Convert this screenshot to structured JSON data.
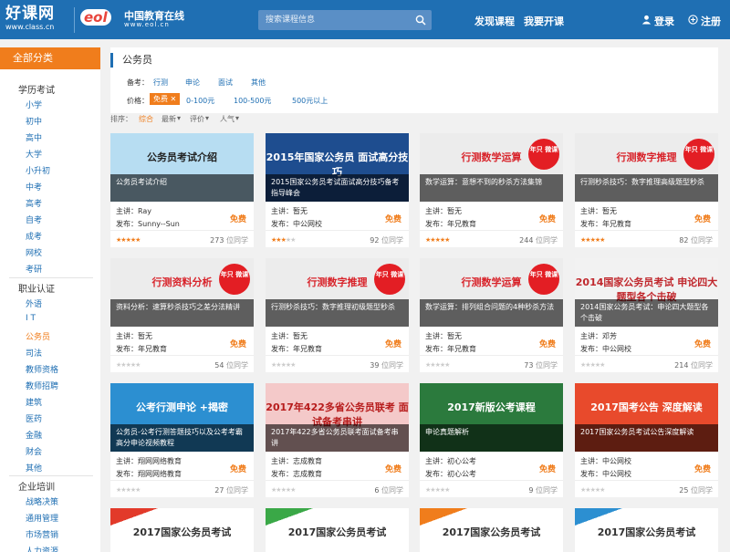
{
  "header": {
    "logo": "好课网",
    "logo_url": "www.class.cn",
    "partner_mark": "eol",
    "partner_name": "中国教育在线",
    "partner_url": "www.eol.cn",
    "search_placeholder": "搜索课程信息",
    "nav": [
      "发现课程",
      "我要开课"
    ],
    "login": "登录",
    "register": "注册"
  },
  "sidebar": {
    "title": "全部分类",
    "groups": [
      {
        "name": "学历考试",
        "items": [
          "小学",
          "初中",
          "高中",
          "大学",
          "小升初",
          "中考",
          "高考",
          "自考",
          "成考",
          "网校",
          "考研"
        ]
      },
      {
        "name": "职业认证",
        "items": [
          "外语",
          "I T",
          "公务员",
          "司法",
          "教师资格",
          "教师招聘",
          "建筑",
          "医药",
          "金融",
          "财会",
          "其他"
        ]
      },
      {
        "name": "企业培训",
        "items": [
          "战略决策",
          "通用管理",
          "市场营销",
          "人力资源"
        ]
      }
    ],
    "active_item": "公务员"
  },
  "filter": {
    "title": "公务员",
    "type_label": "备考：",
    "types": [
      "行测",
      "申论",
      "面试",
      "其他"
    ],
    "price_label": "价格：",
    "price_selected": "免费 ✕",
    "prices": [
      "0-100元",
      "100-500元",
      "500元以上"
    ],
    "sort_label": "排序：",
    "sorts": [
      "综合",
      "最新",
      "评价",
      "人气"
    ]
  },
  "courses": [
    {
      "headline": "公务员考试介绍",
      "badge": "",
      "caption": "公务员考试介绍",
      "teacher": "主讲：Ray",
      "org": "发布：Sunny--Sun",
      "price": "免费",
      "stars": 5,
      "count": "273",
      "unit": "位同学",
      "bg": "#b7ddf2",
      "hl_color": "#222"
    },
    {
      "headline": "2015年国家公务员 面试高分技巧",
      "badge": "",
      "caption": "2015国家公务员考试面试高分技巧备考指导峰会",
      "teacher": "主讲：暂无",
      "org": "发布：中公网校",
      "price": "免费",
      "stars": 3,
      "count": "92",
      "unit": "位同学",
      "bg": "#1e4d8f",
      "hl_color": "#fff"
    },
    {
      "headline": "行测数学运算",
      "badge": "年只 微课",
      "caption": "数学运算：意想不到的秒杀方法集锦",
      "teacher": "主讲：暂无",
      "org": "发布：年兄教育",
      "price": "免费",
      "stars": 5,
      "count": "244",
      "unit": "位同学",
      "bg": "#ececec",
      "hl_color": "#d8232a"
    },
    {
      "headline": "行测数字推理",
      "badge": "年只 微课",
      "caption": "行测秒杀技巧：数字推理高级题型秒杀",
      "teacher": "主讲：暂无",
      "org": "发布：年兄教育",
      "price": "免费",
      "stars": 5,
      "count": "82",
      "unit": "位同学",
      "bg": "#ececec",
      "hl_color": "#d8232a"
    },
    {
      "headline": "行测资料分析",
      "badge": "年只 微课",
      "caption": "资料分析：速算秒杀技巧之差分法精讲",
      "teacher": "主讲：暂无",
      "org": "发布：年兄教育",
      "price": "免费",
      "stars": 0,
      "count": "54",
      "unit": "位同学",
      "bg": "#ececec",
      "hl_color": "#d8232a"
    },
    {
      "headline": "行测数字推理",
      "badge": "年只 微课",
      "caption": "行测秒杀技巧：数字推理初级题型秒杀",
      "teacher": "主讲：暂无",
      "org": "发布：年兄教育",
      "price": "免费",
      "stars": 0,
      "count": "39",
      "unit": "位同学",
      "bg": "#ececec",
      "hl_color": "#d8232a"
    },
    {
      "headline": "行测数学运算",
      "badge": "年只 微课",
      "caption": "数学运算：排列组合问题的4种秒杀方法",
      "teacher": "主讲：暂无",
      "org": "发布：年兄教育",
      "price": "免费",
      "stars": 0,
      "count": "73",
      "unit": "位同学",
      "bg": "#ececec",
      "hl_color": "#d8232a"
    },
    {
      "headline": "2014国家公务员考试 申论四大题型各个击破",
      "badge": "",
      "caption": "2014国家公务员考试：申论四大题型各个击破",
      "teacher": "主讲：邓芳",
      "org": "发布：中公网校",
      "price": "免费",
      "stars": 0,
      "count": "214",
      "unit": "位同学",
      "bg": "#f2f2f2",
      "hl_color": "#c0282d"
    },
    {
      "headline": "公考行测申论 +揭密",
      "badge": "",
      "caption": "公务员-公考行测答题技巧以及公考考霸高分申论视频教程",
      "teacher": "主讲：翔网网络教育",
      "org": "发布：翔网网络教育",
      "price": "免费",
      "stars": 0,
      "count": "27",
      "unit": "位同学",
      "bg": "#2c8fd1",
      "hl_color": "#fff"
    },
    {
      "headline": "2017年422多省公务员联考 面试备考串讲",
      "badge": "",
      "caption": "2017年422多省公务员联考面试备考串讲",
      "teacher": "主讲：志成教育",
      "org": "发布：志成教育",
      "price": "免费",
      "stars": 0,
      "count": "6",
      "unit": "位同学",
      "bg": "#f4c9c9",
      "hl_color": "#b71c1c"
    },
    {
      "headline": "2017新版公考课程",
      "badge": "",
      "caption": "申论真题解析",
      "teacher": "主讲：初心公考",
      "org": "发布：初心公考",
      "price": "免费",
      "stars": 0,
      "count": "9",
      "unit": "位同学",
      "bg": "#2b7a3d",
      "hl_color": "#fff"
    },
    {
      "headline": "2017国考公告 深度解读",
      "badge": "",
      "caption": "2017国家公务员考试公告深度解读",
      "teacher": "主讲：中公网校",
      "org": "发布：中公网校",
      "price": "免费",
      "stars": 0,
      "count": "25",
      "unit": "位同学",
      "bg": "#e84a2c",
      "hl_color": "#fff"
    }
  ],
  "more_courses": [
    {
      "headline": "2017国家公务员考试",
      "band": "#e23a2a"
    },
    {
      "headline": "2017国家公务员考试",
      "band": "#3aa847"
    },
    {
      "headline": "2017国家公务员考试",
      "band": "#f07d1c"
    },
    {
      "headline": "2017国家公务员考试",
      "band": "#2c8fd1"
    }
  ],
  "colors": {
    "brand": "#1f6fb3",
    "accent": "#f07d1c"
  }
}
